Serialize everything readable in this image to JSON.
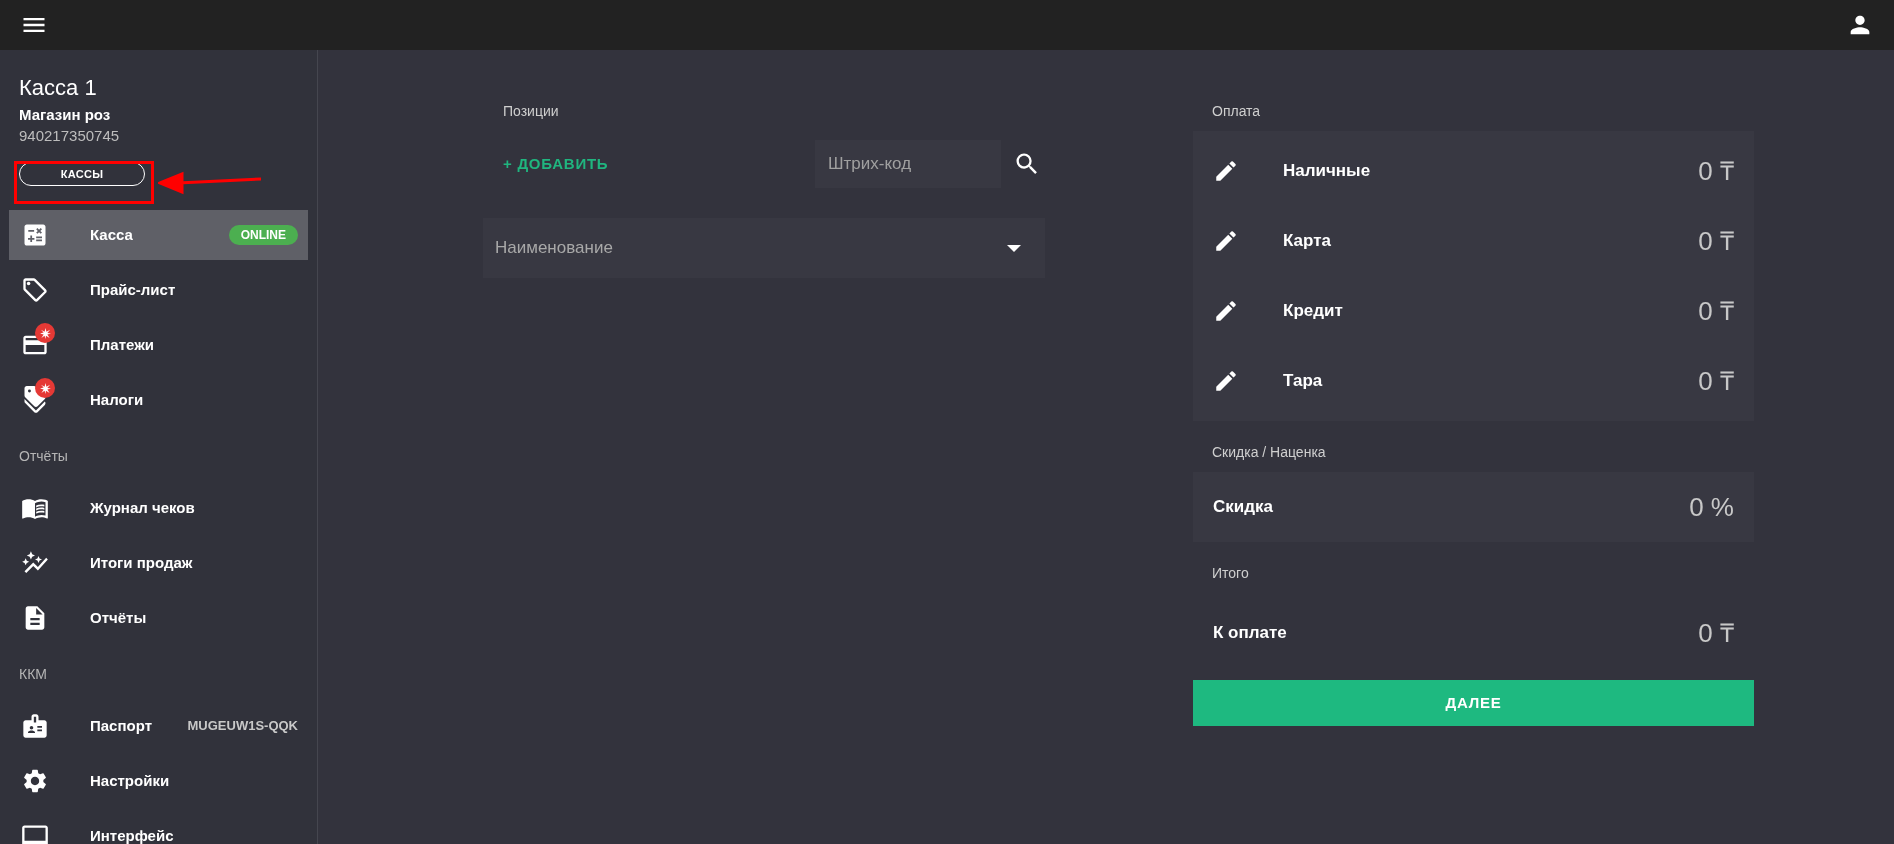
{
  "sidebar": {
    "title": "Касса 1",
    "store": "Магазин роз",
    "id_number": "940217350745",
    "stores_button": "КАССЫ",
    "nav": [
      {
        "kind": "item",
        "label": "Касса",
        "selected": true,
        "alert": false,
        "status": "ONLINE"
      },
      {
        "kind": "item",
        "label": "Прайс-лист",
        "selected": false,
        "alert": false
      },
      {
        "kind": "item",
        "label": "Платежи",
        "selected": false,
        "alert": true
      },
      {
        "kind": "item",
        "label": "Налоги",
        "selected": false,
        "alert": true
      },
      {
        "kind": "header",
        "label": "Отчёты"
      },
      {
        "kind": "item",
        "label": "Журнал чеков",
        "selected": false,
        "alert": false
      },
      {
        "kind": "item",
        "label": "Итоги продаж",
        "selected": false,
        "alert": false
      },
      {
        "kind": "item",
        "label": "Отчёты",
        "selected": false,
        "alert": false
      },
      {
        "kind": "header",
        "label": "ККМ"
      },
      {
        "kind": "item",
        "label": "Паспорт",
        "selected": false,
        "alert": false,
        "note": "MUGEUW1S-QQK"
      },
      {
        "kind": "item",
        "label": "Настройки",
        "selected": false,
        "alert": false
      },
      {
        "kind": "item",
        "label": "Интерфейс",
        "selected": false,
        "alert": false
      }
    ]
  },
  "positions": {
    "label": "Позиции",
    "add_button": "+ ДОБАВИТЬ",
    "barcode": {
      "placeholder": "Штрих-код"
    },
    "name_select": {
      "placeholder": "Наименование"
    }
  },
  "payment": {
    "label": "Оплата",
    "rows": [
      {
        "label": "Наличные",
        "value": "0 ₸"
      },
      {
        "label": "Карта",
        "value": "0 ₸"
      },
      {
        "label": "Кредит",
        "value": "0 ₸"
      },
      {
        "label": "Тара",
        "value": "0 ₸"
      }
    ]
  },
  "discount": {
    "label": "Скидка / Наценка",
    "row": {
      "label": "Скидка",
      "value": "0 %"
    }
  },
  "total": {
    "label": "Итого",
    "row": {
      "label": "К оплате",
      "value": "0 ₸"
    }
  },
  "next_button": "ДАЛЕЕ"
}
